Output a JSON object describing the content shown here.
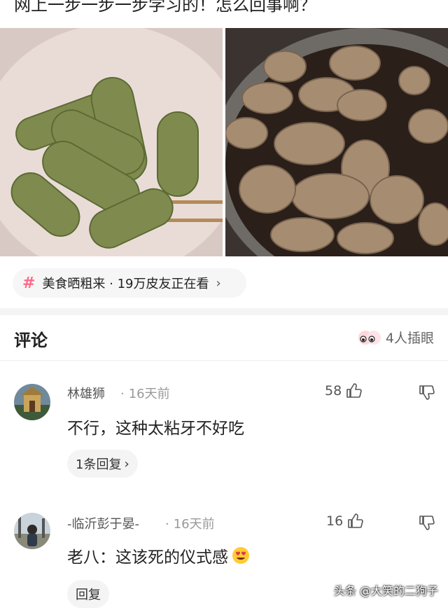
{
  "post": {
    "title": "网上一步一步一步学习的！怎么回事啊？"
  },
  "topic": {
    "label": "美食晒粗来 · 19万皮友正在看",
    "hash_icon": "hash-icon",
    "chevron_icon": "chevron-right-icon"
  },
  "comments_section": {
    "title": "评论",
    "joined_label": "4人插眼"
  },
  "comments": [
    {
      "username": "林雄狮",
      "time": "16天前",
      "likes": "58",
      "text": "不行，这种太粘牙不好吃",
      "reply_label": "1条回复",
      "reply_chevron": "›"
    },
    {
      "username": "-临沂彭于晏-",
      "time": "16天前",
      "likes": "16",
      "text": "老八：这该死的仪式感",
      "reply_label": "回复"
    }
  ],
  "watermark": "头条 @大笑的二狗子",
  "colors": {
    "accent": "#ff6a8a",
    "chip_bg": "#f6f6f6",
    "muted": "#999999"
  }
}
